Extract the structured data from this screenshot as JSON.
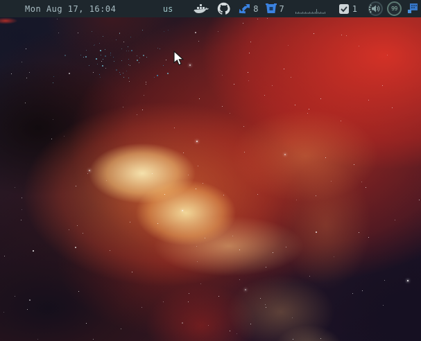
{
  "bar": {
    "clock": "Mon Aug 17, 16:04",
    "keyboard_layout": "us",
    "sync_count": "8",
    "bucket_count": "7",
    "tasks_count": "1",
    "battery_percent": "99"
  },
  "cpu_graph": {
    "type": "bar",
    "bars": [
      3,
      2,
      3,
      2,
      2,
      3,
      2,
      3,
      2,
      2,
      3,
      2,
      3,
      2,
      3,
      7,
      3,
      2,
      3,
      2,
      2,
      3
    ]
  },
  "icons": {
    "docker": "docker-whale-icon",
    "github": "github-octocat-icon",
    "sync": "blue-double-arrows-icon",
    "bucket": "bitbucket-bucket-icon",
    "tasks": "checkbox-icon",
    "volume": "speaker-knob-icon",
    "battery": "battery-circle-indicator",
    "tray": "blue-tiles-icon",
    "cursor": "mouse-arrow-cursor"
  },
  "colors": {
    "bar_bg": "#1e272d",
    "bar_text": "#a9bdc3",
    "accent_blue": "#3b82e0",
    "icon_gray": "#c7d0d4",
    "battery_ring": "#5d7a74",
    "nebula_red": "#c93527",
    "nebula_core": "#f8e8b4"
  }
}
